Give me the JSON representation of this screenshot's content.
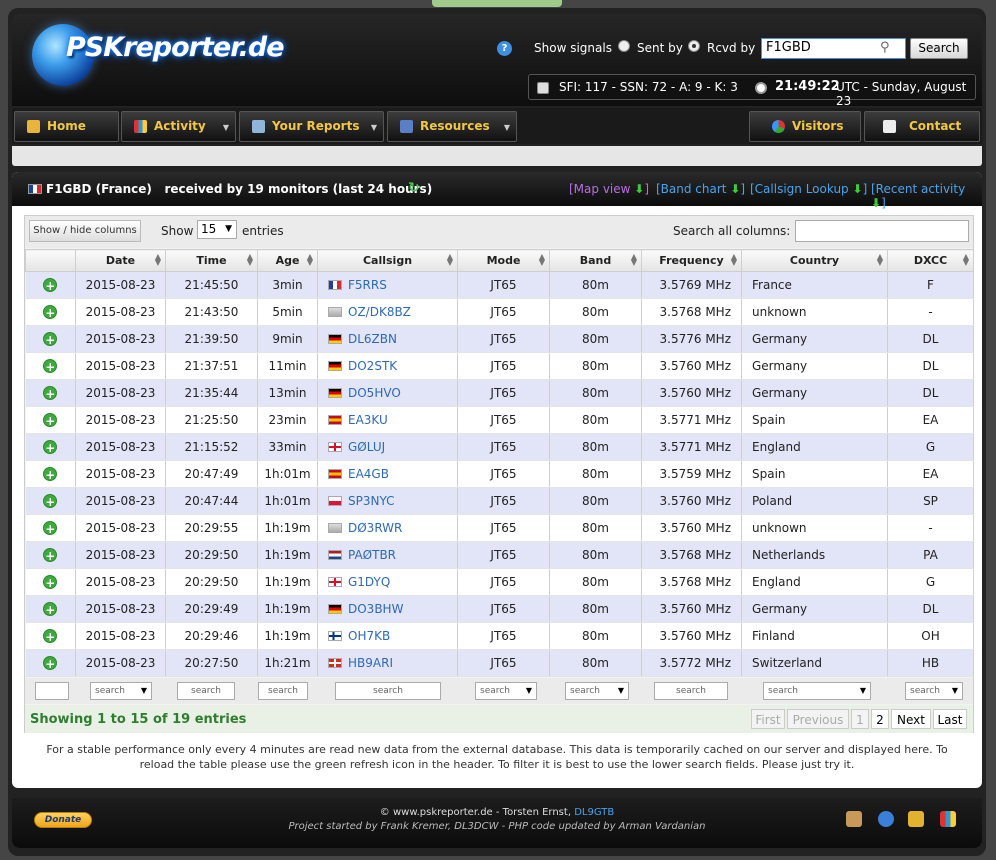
{
  "header": {
    "logo": "PSKreporter.de",
    "show_signals": "Show signals",
    "sent_by": "Sent by",
    "rcvd_by": "Rcvd by",
    "callsign": "F1GBD",
    "search_btn": "Search",
    "solar": "SFI: 117 - SSN: 72 - A: 9 - K: 3",
    "time": "21:49:22",
    "utc_date": "UTC - Sunday, August 23"
  },
  "nav": {
    "home": "Home",
    "activity": "Activity",
    "reports": "Your Reports",
    "resources": "Resources",
    "visitors": "Visitors",
    "contact": "Contact"
  },
  "panel": {
    "title_call": "F1GBD (France)",
    "title_rest": "received by 19 monitors (last 24 hours)",
    "map_view": "[Map view",
    "band_chart": "[Band chart",
    "callsign_lookup": "[Callsign Lookup",
    "recent_activity": "[Recent activity"
  },
  "toolbar": {
    "show_hide": "Show / hide columns",
    "show": "Show",
    "entries_val": "15",
    "entries": "entries",
    "search_all": "Search all columns:"
  },
  "columns": {
    "date": "Date",
    "time": "Time",
    "age": "Age",
    "callsign": "Callsign",
    "mode": "Mode",
    "band": "Band",
    "frequency": "Frequency",
    "country": "Country",
    "dxcc": "DXCC"
  },
  "rows": [
    {
      "date": "2015-08-23",
      "time": "21:45:50",
      "age": "3min",
      "call": "F5RRS",
      "mode": "JT65",
      "band": "80m",
      "freq": "3.5769 MHz",
      "country": "France",
      "dxcc": "F"
    },
    {
      "date": "2015-08-23",
      "time": "21:43:50",
      "age": "5min",
      "call": "OZ/DK8BZ",
      "mode": "JT65",
      "band": "80m",
      "freq": "3.5768 MHz",
      "country": "unknown",
      "dxcc": "-"
    },
    {
      "date": "2015-08-23",
      "time": "21:39:50",
      "age": "9min",
      "call": "DL6ZBN",
      "mode": "JT65",
      "band": "80m",
      "freq": "3.5776 MHz",
      "country": "Germany",
      "dxcc": "DL"
    },
    {
      "date": "2015-08-23",
      "time": "21:37:51",
      "age": "11min",
      "call": "DO2STK",
      "mode": "JT65",
      "band": "80m",
      "freq": "3.5760 MHz",
      "country": "Germany",
      "dxcc": "DL"
    },
    {
      "date": "2015-08-23",
      "time": "21:35:44",
      "age": "13min",
      "call": "DO5HVO",
      "mode": "JT65",
      "band": "80m",
      "freq": "3.5760 MHz",
      "country": "Germany",
      "dxcc": "DL"
    },
    {
      "date": "2015-08-23",
      "time": "21:25:50",
      "age": "23min",
      "call": "EA3KU",
      "mode": "JT65",
      "band": "80m",
      "freq": "3.5771 MHz",
      "country": "Spain",
      "dxcc": "EA"
    },
    {
      "date": "2015-08-23",
      "time": "21:15:52",
      "age": "33min",
      "call": "GØLUJ",
      "mode": "JT65",
      "band": "80m",
      "freq": "3.5771 MHz",
      "country": "England",
      "dxcc": "G"
    },
    {
      "date": "2015-08-23",
      "time": "20:47:49",
      "age": "1h:01m",
      "call": "EA4GB",
      "mode": "JT65",
      "band": "80m",
      "freq": "3.5759 MHz",
      "country": "Spain",
      "dxcc": "EA"
    },
    {
      "date": "2015-08-23",
      "time": "20:47:44",
      "age": "1h:01m",
      "call": "SP3NYC",
      "mode": "JT65",
      "band": "80m",
      "freq": "3.5760 MHz",
      "country": "Poland",
      "dxcc": "SP"
    },
    {
      "date": "2015-08-23",
      "time": "20:29:55",
      "age": "1h:19m",
      "call": "DØ3RWR",
      "mode": "JT65",
      "band": "80m",
      "freq": "3.5760 MHz",
      "country": "unknown",
      "dxcc": "-"
    },
    {
      "date": "2015-08-23",
      "time": "20:29:50",
      "age": "1h:19m",
      "call": "PAØTBR",
      "mode": "JT65",
      "band": "80m",
      "freq": "3.5768 MHz",
      "country": "Netherlands",
      "dxcc": "PA"
    },
    {
      "date": "2015-08-23",
      "time": "20:29:50",
      "age": "1h:19m",
      "call": "G1DYQ",
      "mode": "JT65",
      "band": "80m",
      "freq": "3.5768 MHz",
      "country": "England",
      "dxcc": "G"
    },
    {
      "date": "2015-08-23",
      "time": "20:29:49",
      "age": "1h:19m",
      "call": "DO3BHW",
      "mode": "JT65",
      "band": "80m",
      "freq": "3.5760 MHz",
      "country": "Germany",
      "dxcc": "DL"
    },
    {
      "date": "2015-08-23",
      "time": "20:29:46",
      "age": "1h:19m",
      "call": "OH7KB",
      "mode": "JT65",
      "band": "80m",
      "freq": "3.5760 MHz",
      "country": "Finland",
      "dxcc": "OH"
    },
    {
      "date": "2015-08-23",
      "time": "20:27:50",
      "age": "1h:21m",
      "call": "HB9ARI",
      "mode": "JT65",
      "band": "80m",
      "freq": "3.5772 MHz",
      "country": "Switzerland",
      "dxcc": "HB"
    }
  ],
  "filter_placeholder": "search",
  "footer_table": {
    "showing": "Showing 1 to 15 of 19 entries",
    "first": "First",
    "previous": "Previous",
    "p1": "1",
    "p2": "2",
    "next": "Next",
    "last": "Last"
  },
  "note": "For a stable performance only every 4 minutes are read new data from the external database. This data is temporarily cached on our server and displayed here. To reload the table please use the green refresh icon in the header. To filter it is best to use the lower search fields. Please just try it.",
  "footer": {
    "donate": "Donate",
    "copyright": "© www.pskreporter.de - Torsten Ernst,",
    "copyright_call": "DL9GTB",
    "credits": "Project started by Frank Kremer, DL3DCW - PHP code updated by Arman Vardanian"
  },
  "colors": {
    "accent_link": "#2e6ab3",
    "nav_text": "#f4c742",
    "showing_green": "#2f7d2f",
    "row_odd": "#e2e4f7"
  },
  "flags": {
    "France": [
      "#1f3f9e",
      "#ffffff",
      "#d22d2d"
    ],
    "Germany": [
      "#000000",
      "#dd0000",
      "#ffcc00"
    ],
    "Spain": [
      "#c60b1e",
      "#ffc400",
      "#c60b1e"
    ],
    "Netherlands": [
      "#ae1c28",
      "#ffffff",
      "#21468b"
    ],
    "Poland": [
      "#ffffff",
      "#dc143c"
    ],
    "England": [
      "#ffffff",
      "#cf142b"
    ],
    "Finland": [
      "#ffffff",
      "#003580"
    ],
    "Switzerland": [
      "#d52b1e",
      "#ffffff"
    ],
    "unknown": [
      "#cccccc",
      "#888888"
    ]
  }
}
